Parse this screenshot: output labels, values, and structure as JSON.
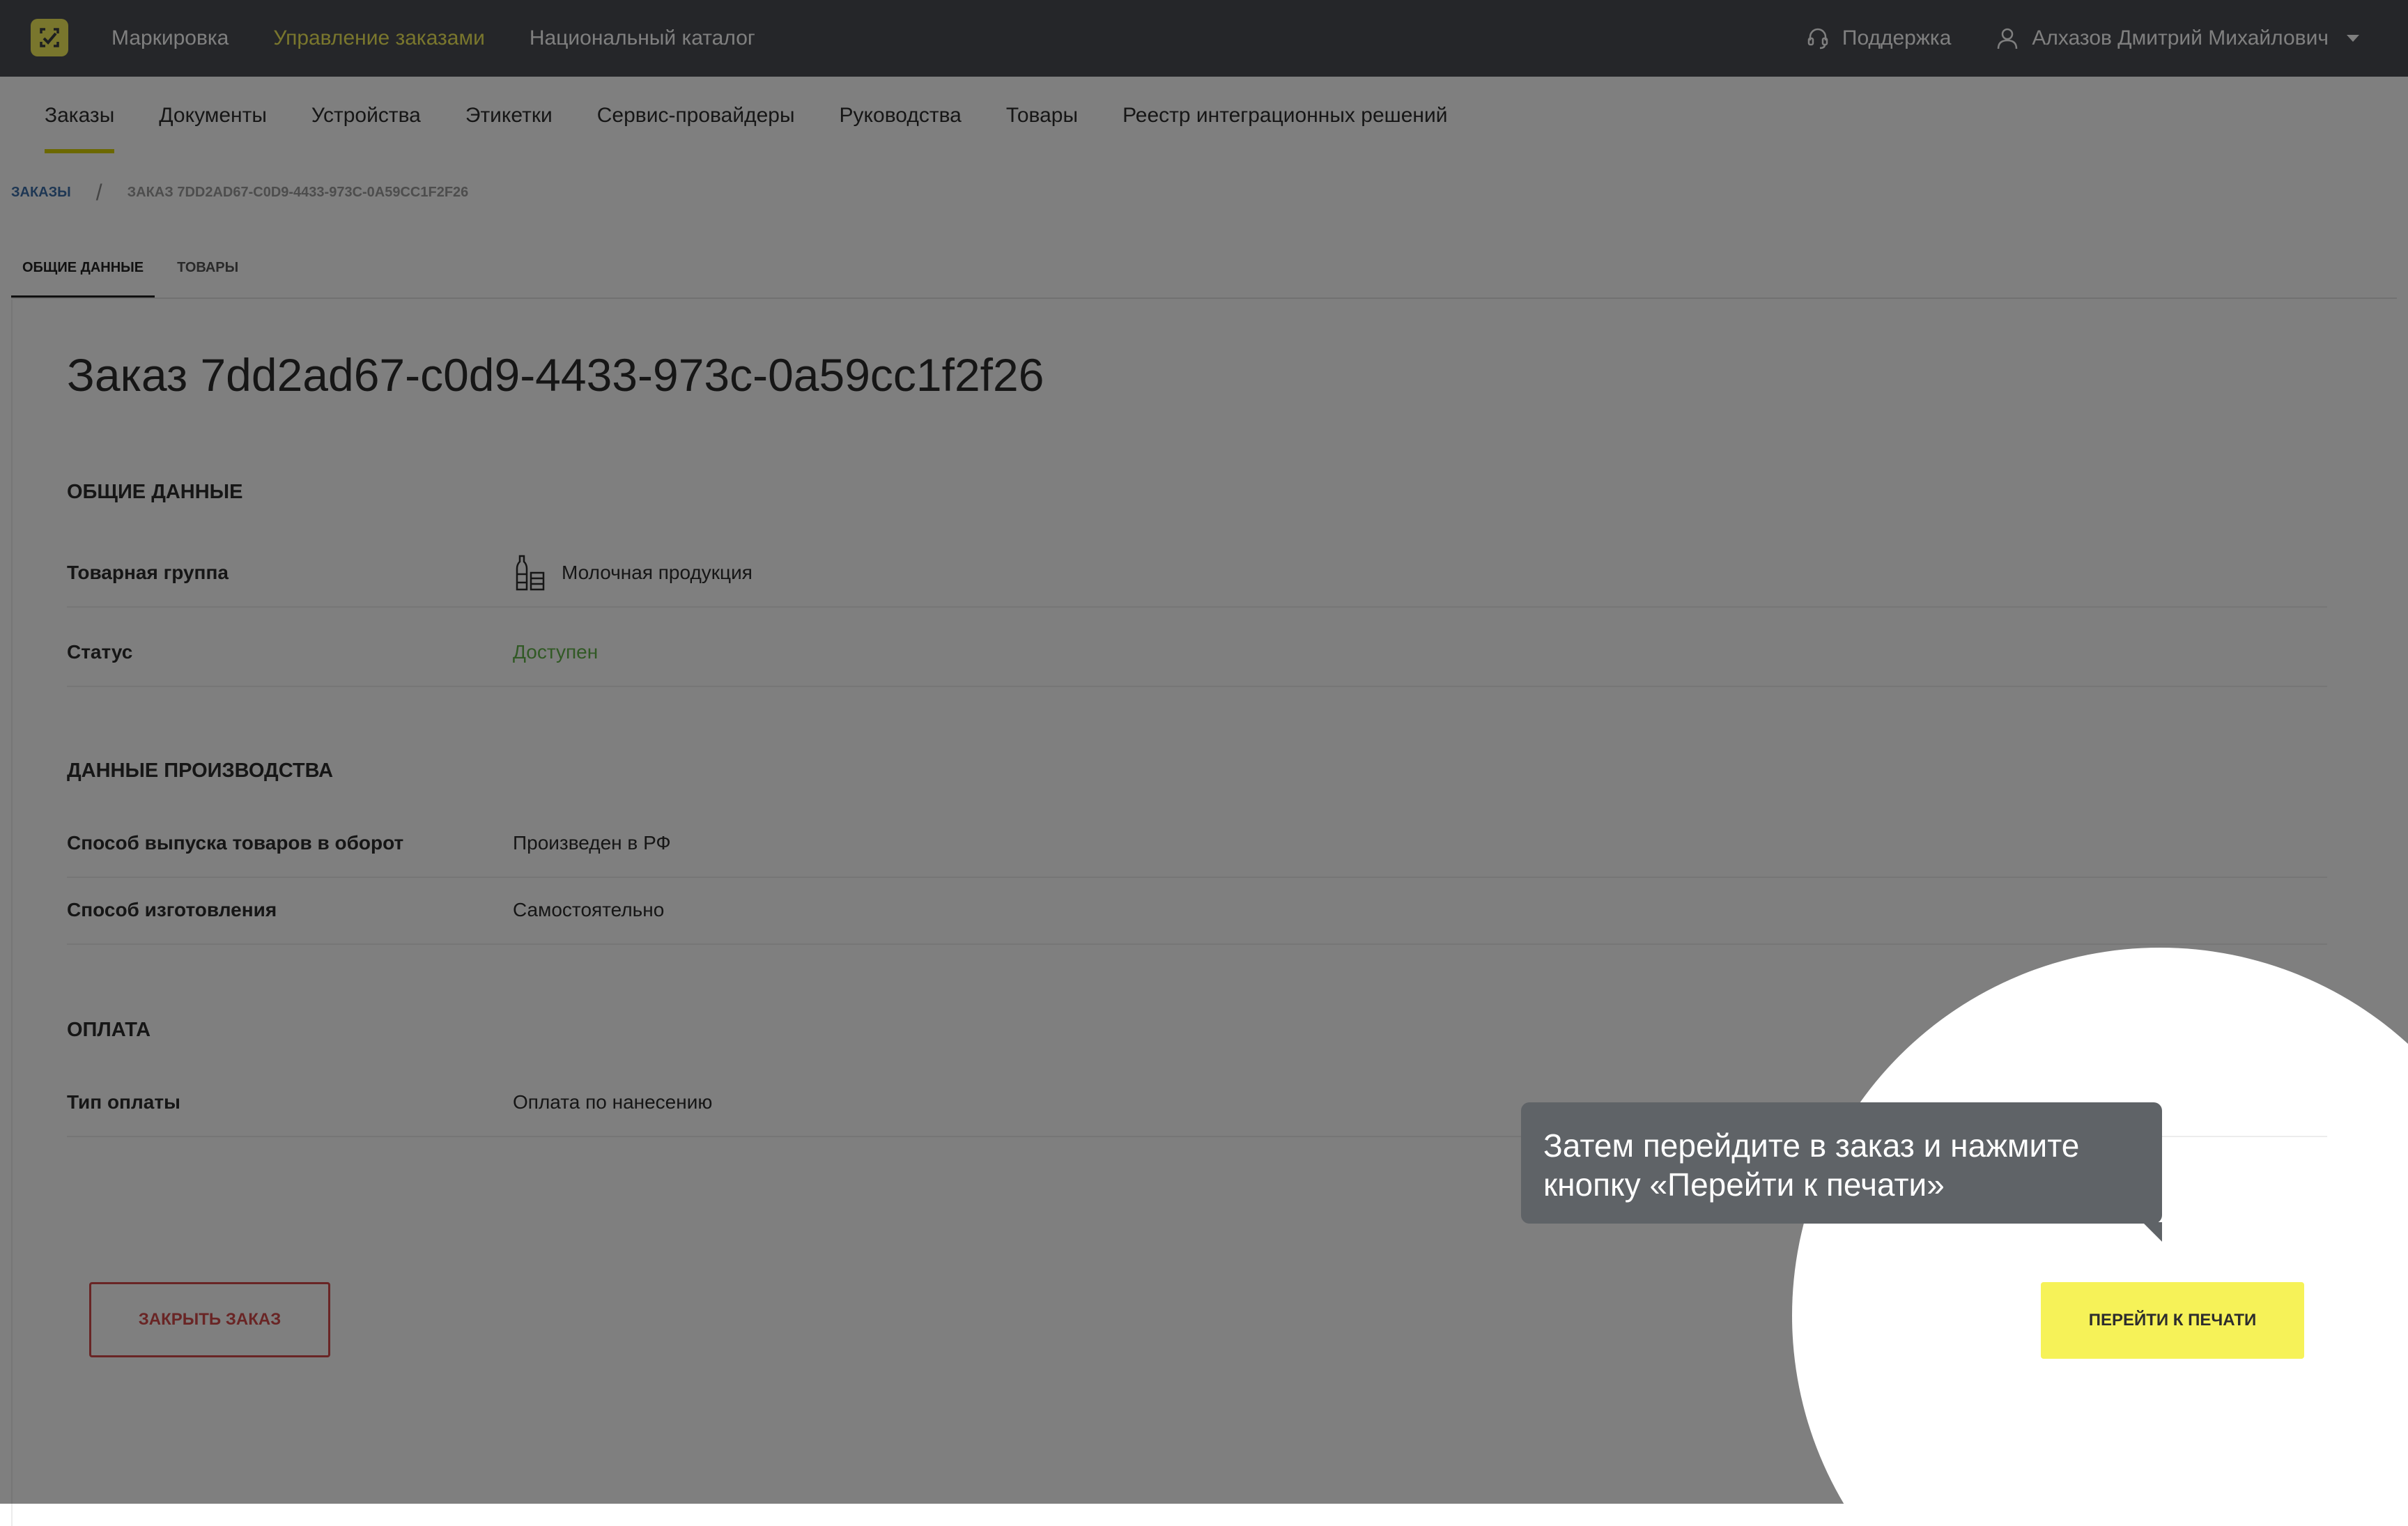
{
  "topbar": {
    "nav": [
      "Маркировка",
      "Управление заказами",
      "Национальный каталог"
    ],
    "support_label": "Поддержка",
    "user_name": "Алхазов Дмитрий Михайлович"
  },
  "subnav": {
    "tabs": [
      "Заказы",
      "Документы",
      "Устройства",
      "Этикетки",
      "Сервис-провайдеры",
      "Руководства",
      "Товары",
      "Реестр интеграционных решений"
    ]
  },
  "breadcrumb": {
    "root": "Заказы",
    "current": "Заказ 7DD2AD67-C0D9-4433-973C-0A59CC1F2F26"
  },
  "page_tabs": [
    "Общие данные",
    "Товары"
  ],
  "order": {
    "title": "Заказ 7dd2ad67-c0d9-4433-973c-0a59cc1f2f26",
    "general": {
      "heading": "ОБЩИЕ ДАННЫЕ",
      "product_group_label": "Товарная группа",
      "product_group_value": "Молочная продукция",
      "status_label": "Статус",
      "status_value": "Доступен",
      "status_color": "#62b34a"
    },
    "production": {
      "heading": "ДАННЫЕ ПРОИЗВОДСТВА",
      "release_label": "Способ выпуска товаров в оборот",
      "release_value": "Произведен в РФ",
      "manufacture_label": "Способ изготовления",
      "manufacture_value": "Самостоятельно"
    },
    "payment": {
      "heading": "ОПЛАТА",
      "type_label": "Тип оплаты",
      "type_value": "Оплата по нанесению"
    }
  },
  "actions": {
    "close_label": "ЗАКРЫТЬ ЗАКАЗ",
    "print_label": "ПЕРЕЙТИ К ПЕЧАТИ"
  },
  "tooltip": {
    "line1": "Затем перейдите в заказ и нажмите",
    "line2": "кнопку «Перейти к печати»"
  },
  "colors": {
    "accent_yellow": "#f3ec5a",
    "topbar_bg": "#4a4d52",
    "danger": "#d24b4b",
    "link": "#3d6fa8"
  },
  "icons": [
    "logo-icon",
    "headset-icon",
    "user-icon",
    "dairy-icon"
  ]
}
